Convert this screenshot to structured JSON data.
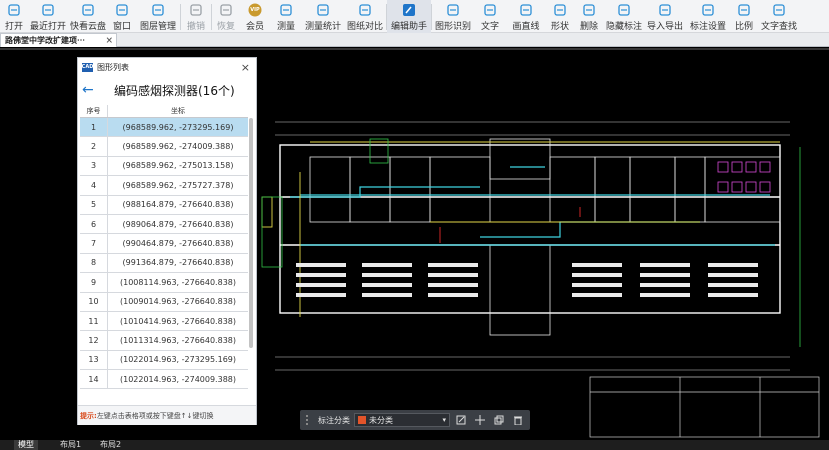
{
  "toolbar": {
    "items": [
      {
        "label": "打开",
        "icon": "open-folder-icon"
      },
      {
        "label": "最近打开",
        "icon": "recent-icon"
      },
      {
        "label": "快看云盘",
        "icon": "cloud-icon"
      },
      {
        "label": "窗口",
        "icon": "window-icon"
      },
      {
        "label": "图层管理",
        "icon": "layers-icon"
      },
      {
        "label": "撤销",
        "icon": "undo-icon"
      },
      {
        "label": "恢复",
        "icon": "redo-icon"
      },
      {
        "label": "会员",
        "icon": "vip-icon"
      },
      {
        "label": "测量",
        "icon": "measure-icon"
      },
      {
        "label": "测量统计",
        "icon": "measure-stats-icon"
      },
      {
        "label": "图纸对比",
        "icon": "compare-icon"
      },
      {
        "label": "编辑助手",
        "icon": "edit-assistant-icon"
      },
      {
        "label": "图形识别",
        "icon": "shape-recognition-icon"
      },
      {
        "label": "文字",
        "icon": "text-icon"
      },
      {
        "label": "画直线",
        "icon": "line-icon"
      },
      {
        "label": "形状",
        "icon": "shape-icon"
      },
      {
        "label": "删除",
        "icon": "delete-icon"
      },
      {
        "label": "隐藏标注",
        "icon": "hide-annotation-icon"
      },
      {
        "label": "导入导出",
        "icon": "import-export-icon"
      },
      {
        "label": "标注设置",
        "icon": "annotation-settings-icon"
      },
      {
        "label": "比例",
        "icon": "scale-icon"
      },
      {
        "label": "文字查找",
        "icon": "text-search-icon"
      }
    ],
    "vip_badge": "VIP"
  },
  "document_tab": {
    "label": "路佛堂中学改扩建项⋯",
    "close": "×"
  },
  "panel": {
    "window_title": "图形列表",
    "logo": "CAD",
    "close": "×",
    "back": "←",
    "heading": "编码感烟探测器(16个)",
    "columns": [
      "序号",
      "坐标"
    ],
    "rows": [
      {
        "no": "1",
        "coord": "(968589.962, -273295.169)"
      },
      {
        "no": "2",
        "coord": "(968589.962, -274009.388)"
      },
      {
        "no": "3",
        "coord": "(968589.962, -275013.158)"
      },
      {
        "no": "4",
        "coord": "(968589.962, -275727.378)"
      },
      {
        "no": "5",
        "coord": "(988164.879, -276640.838)"
      },
      {
        "no": "6",
        "coord": "(989064.879, -276640.838)"
      },
      {
        "no": "7",
        "coord": "(990464.879, -276640.838)"
      },
      {
        "no": "8",
        "coord": "(991364.879, -276640.838)"
      },
      {
        "no": "9",
        "coord": "(1008114.963, -276640.838)"
      },
      {
        "no": "10",
        "coord": "(1009014.963, -276640.838)"
      },
      {
        "no": "11",
        "coord": "(1010414.963, -276640.838)"
      },
      {
        "no": "12",
        "coord": "(1011314.963, -276640.838)"
      },
      {
        "no": "13",
        "coord": "(1022014.963, -273295.169)"
      },
      {
        "no": "14",
        "coord": "(1022014.963, -274009.388)"
      }
    ],
    "selected_row": "1",
    "footer_tip": "提示:",
    "footer_text": "左键点击表格项或按下键盘↑↓键切换"
  },
  "floatbar": {
    "label": "标注分类",
    "category": "未分类",
    "category_color": "#e2542a"
  },
  "bottom_tabs": [
    "模型",
    "布局1",
    "布局2"
  ],
  "colors": {
    "accent": "#1f75c9",
    "selected_row": "#b9dcf0",
    "cad_bg": "#000000"
  }
}
